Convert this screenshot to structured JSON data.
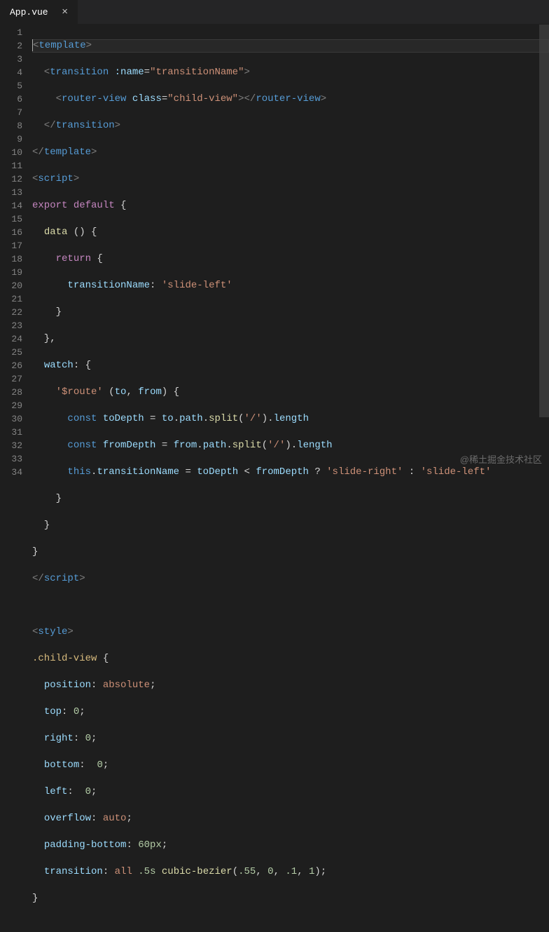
{
  "tab": {
    "title": "App.vue"
  },
  "lines": [
    1,
    2,
    3,
    4,
    5,
    6,
    7,
    8,
    9,
    10,
    11,
    12,
    13,
    14,
    15,
    16,
    17,
    18,
    19,
    20,
    21,
    22,
    23,
    24,
    25,
    26,
    27,
    28,
    29,
    30,
    31,
    32,
    33,
    34
  ],
  "code": {
    "l1": {
      "a": "<",
      "b": "template",
      "c": ">"
    },
    "l2": {
      "a": "  <",
      "b": "transition",
      "sp": " ",
      "c": ":name",
      "d": "=",
      "e": "\"transitionName\"",
      "f": ">"
    },
    "l3": {
      "a": "    <",
      "b": "router-view",
      "sp": " ",
      "c": "class",
      "d": "=",
      "e": "\"child-view\"",
      "f": ">",
      "g": "</",
      "h": "router-view",
      "i": ">"
    },
    "l4": {
      "a": "  </",
      "b": "transition",
      "c": ">"
    },
    "l5": {
      "a": "</",
      "b": "template",
      "c": ">"
    },
    "l6": {
      "a": "<",
      "b": "script",
      "c": ">"
    },
    "l7": {
      "a": "export",
      "sp": " ",
      "b": "default",
      "c": " {"
    },
    "l8": {
      "a": "  ",
      "b": "data",
      "c": " () {"
    },
    "l9": {
      "a": "    ",
      "b": "return",
      "c": " {"
    },
    "l10": {
      "a": "      ",
      "b": "transitionName",
      "c": ": ",
      "d": "'slide-left'"
    },
    "l11": {
      "a": "    }"
    },
    "l12": {
      "a": "  },"
    },
    "l13": {
      "a": "  ",
      "b": "watch",
      "c": ": {"
    },
    "l14": {
      "a": "    ",
      "b": "'$route'",
      "c": " (",
      "d": "to",
      "e": ", ",
      "f": "from",
      "g": ") {"
    },
    "l15": {
      "a": "      ",
      "b": "const",
      "c": " ",
      "d": "toDepth",
      "e": " = ",
      "f": "to",
      "g": ".",
      "h": "path",
      "i": ".",
      "j": "split",
      "k": "(",
      "l": "'/'",
      "m": ").",
      "n": "length"
    },
    "l16": {
      "a": "      ",
      "b": "const",
      "c": " ",
      "d": "fromDepth",
      "e": " = ",
      "f": "from",
      "g": ".",
      "h": "path",
      "i": ".",
      "j": "split",
      "k": "(",
      "l": "'/'",
      "m": ").",
      "n": "length"
    },
    "l17": {
      "a": "      ",
      "b": "this",
      "c": ".",
      "d": "transitionName",
      "e": " = ",
      "f": "toDepth",
      "g": " < ",
      "h": "fromDepth",
      "i": " ? ",
      "j": "'slide-right'",
      "k": " : ",
      "l": "'slide-left'"
    },
    "l18": {
      "a": "    }"
    },
    "l19": {
      "a": "  }"
    },
    "l20": {
      "a": "}"
    },
    "l21": {
      "a": "</",
      "b": "script",
      "c": ">"
    },
    "l22": {
      "a": ""
    },
    "l23": {
      "a": "<",
      "b": "style",
      "c": ">"
    },
    "l24": {
      "a": ".child-view",
      "b": " {"
    },
    "l25": {
      "a": "  ",
      "b": "position",
      "c": ": ",
      "d": "absolute",
      "e": ";"
    },
    "l26": {
      "a": "  ",
      "b": "top",
      "c": ": ",
      "d": "0",
      "e": ";"
    },
    "l27": {
      "a": "  ",
      "b": "right",
      "c": ": ",
      "d": "0",
      "e": ";"
    },
    "l28": {
      "a": "  ",
      "b": "bottom",
      "c": ":  ",
      "d": "0",
      "e": ";"
    },
    "l29": {
      "a": "  ",
      "b": "left",
      "c": ":  ",
      "d": "0",
      "e": ";"
    },
    "l30": {
      "a": "  ",
      "b": "overflow",
      "c": ": ",
      "d": "auto",
      "e": ";"
    },
    "l31": {
      "a": "  ",
      "b": "padding-bottom",
      "c": ": ",
      "d": "60px",
      "e": ";"
    },
    "l32": {
      "a": "  ",
      "b": "transition",
      "c": ": ",
      "d": "all",
      "e": " ",
      "f": ".5s",
      "g": " ",
      "h": "cubic-bezier",
      "i": "(",
      "j": ".55",
      "k": ", ",
      "l": "0",
      "m": ", ",
      "n": ".1",
      "o": ", ",
      "p": "1",
      "q": ");"
    },
    "l33": {
      "a": "}"
    }
  },
  "watermark": "@稀土掘金技术社区"
}
